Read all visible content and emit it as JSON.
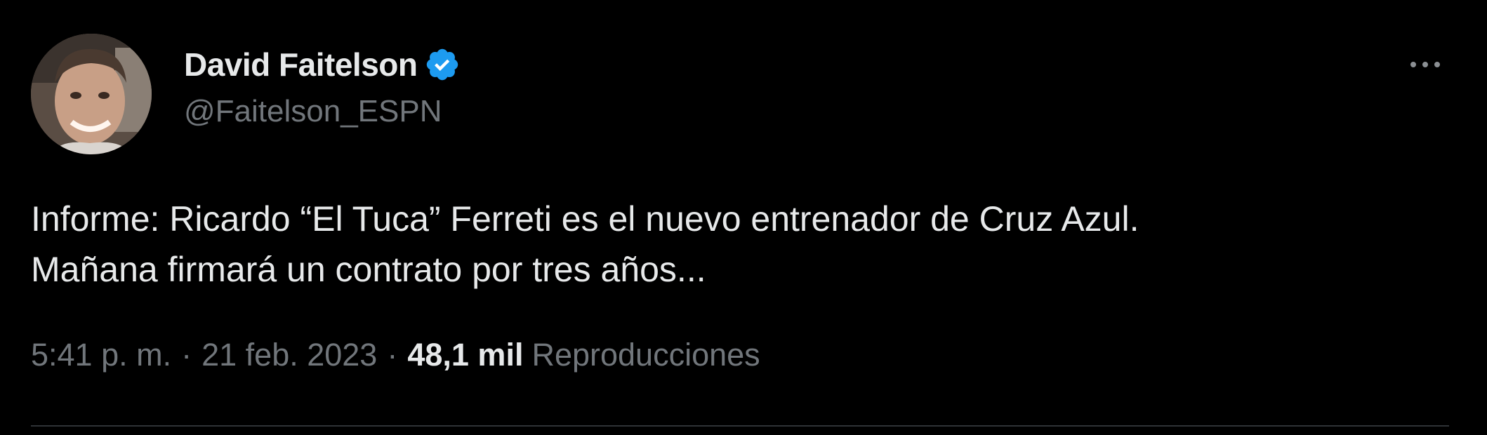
{
  "author": {
    "name": "David Faitelson",
    "handle": "@Faitelson_ESPN",
    "verified": true,
    "verified_color": "#1d9bf0"
  },
  "tweet": {
    "line1": "Informe: Ricardo “El Tuca” Ferreti es el nuevo entrenador de Cruz Azul.",
    "line2": "Mañana firmará un contrato por tres años..."
  },
  "meta": {
    "time": "5:41 p. m.",
    "separator": "·",
    "date": "21 feb. 2023",
    "views_count": "48,1 mil",
    "views_label": "Reproducciones"
  },
  "icons": {
    "more": "more-horizontal-icon",
    "verified": "verified-badge-icon"
  }
}
